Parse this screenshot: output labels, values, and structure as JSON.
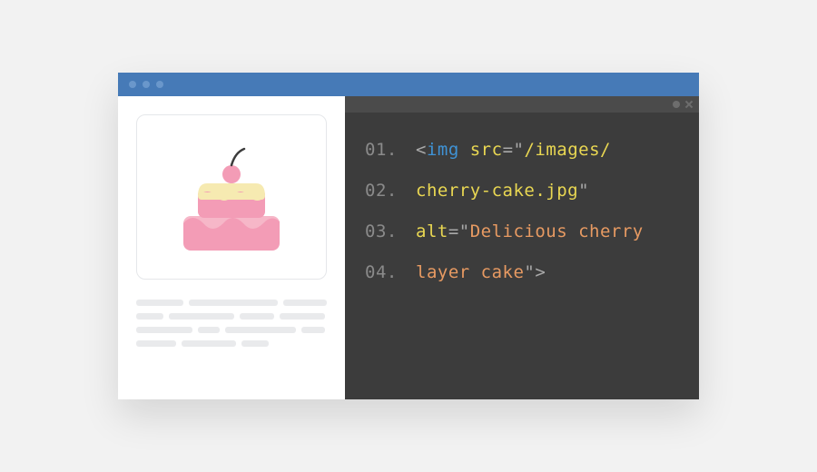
{
  "code": {
    "line_numbers": [
      "01.",
      "02.",
      "03.",
      "04."
    ],
    "tag": "img",
    "attr_src": "src",
    "attr_alt": "alt",
    "src_part1": "/images/",
    "src_part2": "cherry-cake.jpg",
    "alt_part1": "Delicious cherry",
    "alt_part2": "layer cake",
    "lt": "<",
    "gt": ">",
    "eq_quote": "=\"",
    "quote": "\"",
    "space": " "
  }
}
